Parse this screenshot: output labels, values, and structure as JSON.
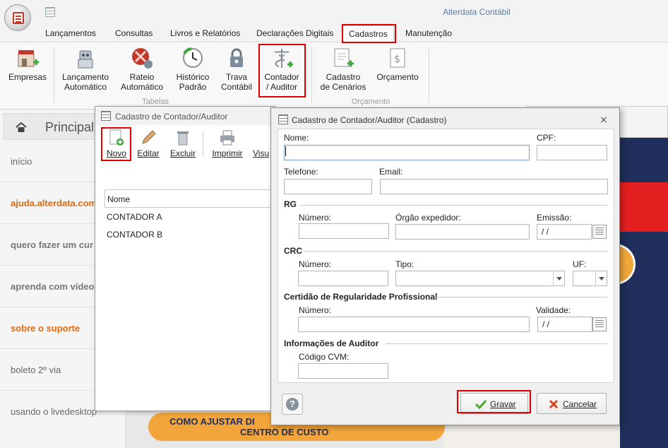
{
  "app": {
    "title": "Alterdata Contábil"
  },
  "menu": {
    "tabs": [
      "Lançamentos",
      "Consultas",
      "Livros e Relatórios",
      "Declarações Digitais",
      "Cadastros",
      "Manutenção"
    ],
    "active": "Cadastros"
  },
  "ribbon": {
    "empresas": "Empresas",
    "lancamento_1": "Lançamento",
    "lancamento_2": "Automático",
    "rateio_1": "Rateio",
    "rateio_2": "Automático",
    "historico_1": "Histórico",
    "historico_2": "Padrão",
    "trava_1": "Trava",
    "trava_2": "Contábil",
    "contador_1": "Contador",
    "contador_2": "/ Auditor",
    "cenarios_1": "Cadastro",
    "cenarios_2": "de Cenários",
    "orcamento": "Orçamento",
    "group_tabelas": "Tabelas",
    "group_orcamento": "Orçamento"
  },
  "sidebar": {
    "title": "Principal",
    "items": [
      "início",
      "ajuda.alterdata.com",
      "quero fazer um cur",
      "aprenda com vídeo",
      "sobre o suporte",
      "boleto 2º via",
      "usando o livedesktop"
    ]
  },
  "banner": {
    "line1": "COMO AJUSTAR DI",
    "line2": "CENTRO DE CUSTO"
  },
  "list_window": {
    "title": "Cadastro de Contador/Auditor",
    "toolbar": {
      "novo": "Novo",
      "editar": "Editar",
      "excluir": "Excluir",
      "imprimir": "Imprimir",
      "visualizar": "Visu"
    },
    "column_header": "Nome",
    "rows": [
      "CONTADOR A",
      "CONTADOR B"
    ]
  },
  "dialog": {
    "title": "Cadastro de Contador/Auditor (Cadastro)",
    "close": "⨯",
    "labels": {
      "nome": "Nome:",
      "cpf": "CPF:",
      "telefone": "Telefone:",
      "email": "Email:",
      "rg_section": "RG",
      "rg_numero": "Número:",
      "rg_orgao": "Órgão expedidor:",
      "rg_emissao": "Emissão:",
      "crc_section": "CRC",
      "crc_numero": "Número:",
      "crc_tipo": "Tipo:",
      "crc_uf": "UF:",
      "certidao_section": "Certidão de Regularidade Profissional",
      "cert_numero": "Número:",
      "cert_validade": "Validade:",
      "auditor_section": "Informações de Auditor",
      "codigo_cvm": "Código CVM:"
    },
    "values": {
      "nome": "",
      "cpf": "",
      "telefone": "",
      "email": "",
      "rg_numero": "",
      "rg_orgao": "",
      "rg_emissao": " /  /",
      "crc_numero": "",
      "crc_tipo": "",
      "crc_uf": "",
      "cert_numero": "",
      "cert_validade": " /  /",
      "codigo_cvm": ""
    },
    "buttons": {
      "help": "?",
      "gravar": "Gravar",
      "cancelar": "Cancelar"
    }
  }
}
